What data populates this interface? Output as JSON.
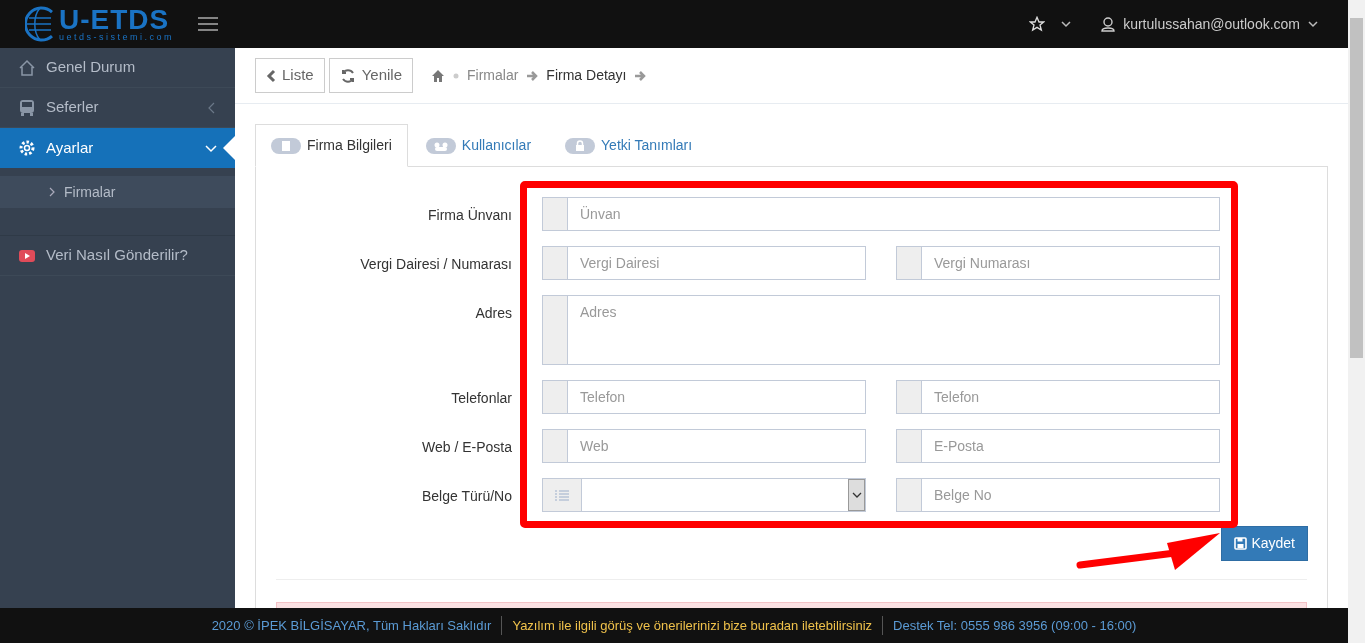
{
  "brand": {
    "name": "U-ETDS",
    "tagline": "uetds-sistemi.com"
  },
  "user": {
    "email": "kurtulussahan@outlook.com"
  },
  "sidebar": {
    "items": [
      {
        "label": "Genel Durum",
        "selected": false
      },
      {
        "label": "Seferler",
        "selected": false,
        "expanded": false
      },
      {
        "label": "Ayarlar",
        "selected": true,
        "expanded": true,
        "children": [
          {
            "label": "Firmalar",
            "selected": true
          }
        ]
      },
      {
        "label": "Veri Nasıl Gönderilir?",
        "selected": false
      }
    ]
  },
  "toolbar": {
    "buttons": [
      {
        "label": "Liste"
      },
      {
        "label": "Yenile"
      }
    ],
    "breadcrumb": [
      {
        "label": "Firmalar",
        "current": false
      },
      {
        "label": "Firma Detayı",
        "current": true
      }
    ]
  },
  "tabs": [
    {
      "label": "Firma Bilgileri",
      "selected": true
    },
    {
      "label": "Kullanıcılar",
      "selected": false
    },
    {
      "label": "Yetki Tanımları",
      "selected": false
    }
  ],
  "form": {
    "rows": [
      {
        "label": "Firma Ünvanı",
        "fields": [
          {
            "kind": "text",
            "placeholder": "Ünvan"
          }
        ]
      },
      {
        "label": "Vergi Dairesi / Numarası",
        "fields": [
          {
            "kind": "text",
            "placeholder": "Vergi Dairesi"
          },
          {
            "kind": "text",
            "placeholder": "Vergi Numarası"
          }
        ]
      },
      {
        "label": "Adres",
        "fields": [
          {
            "kind": "textarea",
            "placeholder": "Adres"
          }
        ]
      },
      {
        "label": "Telefonlar",
        "fields": [
          {
            "kind": "text",
            "placeholder": "Telefon"
          },
          {
            "kind": "text",
            "placeholder": "Telefon"
          }
        ]
      },
      {
        "label": "Web / E-Posta",
        "fields": [
          {
            "kind": "text",
            "placeholder": "Web"
          },
          {
            "kind": "text",
            "placeholder": "E-Posta"
          }
        ]
      },
      {
        "label": "Belge Türü/No",
        "fields": [
          {
            "kind": "select"
          },
          {
            "kind": "text",
            "placeholder": "Belge No"
          }
        ]
      }
    ],
    "save_button": "Kaydet"
  },
  "footer": [
    {
      "text": "2020 © İPEK BİLGİSAYAR, Tüm Hakları Saklıdır",
      "color": "#5b9bd5"
    },
    {
      "text": "Yazılım ile ilgili görüş ve önerilerinizi bize buradan iletebilirsiniz",
      "color": "#f0c24b"
    },
    {
      "text": "Destek Tel: 0555 986 3956 (09:00 - 16:00)",
      "color": "#5b9bd5"
    }
  ]
}
